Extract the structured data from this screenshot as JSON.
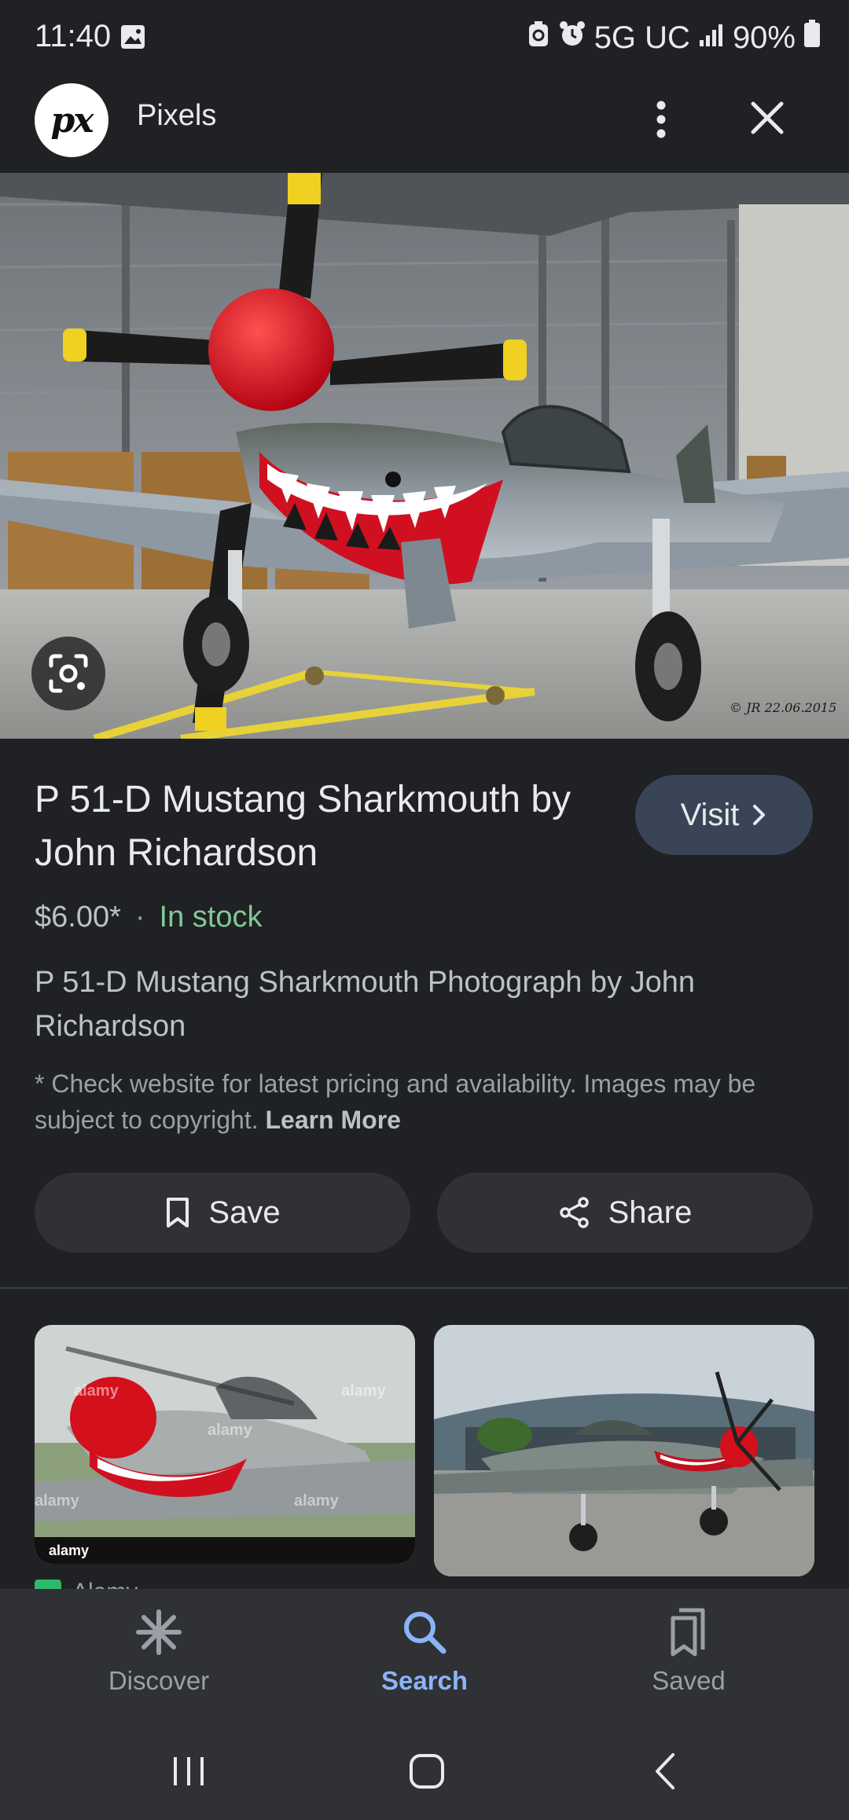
{
  "status_bar": {
    "time": "11:40",
    "network": "5G UC",
    "battery": "90%",
    "icons": [
      "gallery-icon",
      "recycle-icon",
      "alarm-icon",
      "signal-icon",
      "battery-icon"
    ]
  },
  "header": {
    "logo_text": "px",
    "site_name": "Pixels"
  },
  "product": {
    "title": "P 51-D Mustang Sharkmouth by John Richardson",
    "visit_label": "Visit",
    "price": "$6.00*",
    "separator": "·",
    "stock": "In stock",
    "description": "P 51-D Mustang Sharkmouth Photograph by John Richardson",
    "disclaimer": "* Check website for latest pricing and availability. Images may be subject to copyright.",
    "learn_more": "Learn More",
    "image_watermark": "© JR 22.06.2015"
  },
  "actions": {
    "save_label": "Save",
    "share_label": "Share"
  },
  "related": {
    "source_1": "Alamy",
    "watermark": "alamy"
  },
  "bottom_nav": {
    "items": [
      {
        "label": "Discover",
        "icon": "asterisk-icon"
      },
      {
        "label": "Search",
        "icon": "search-icon",
        "active": true
      },
      {
        "label": "Saved",
        "icon": "bookmarks-icon"
      }
    ]
  },
  "colors": {
    "background": "#202124",
    "visit_button": "#394457",
    "in_stock": "#81c995",
    "active_nav": "#8ab4f8"
  }
}
